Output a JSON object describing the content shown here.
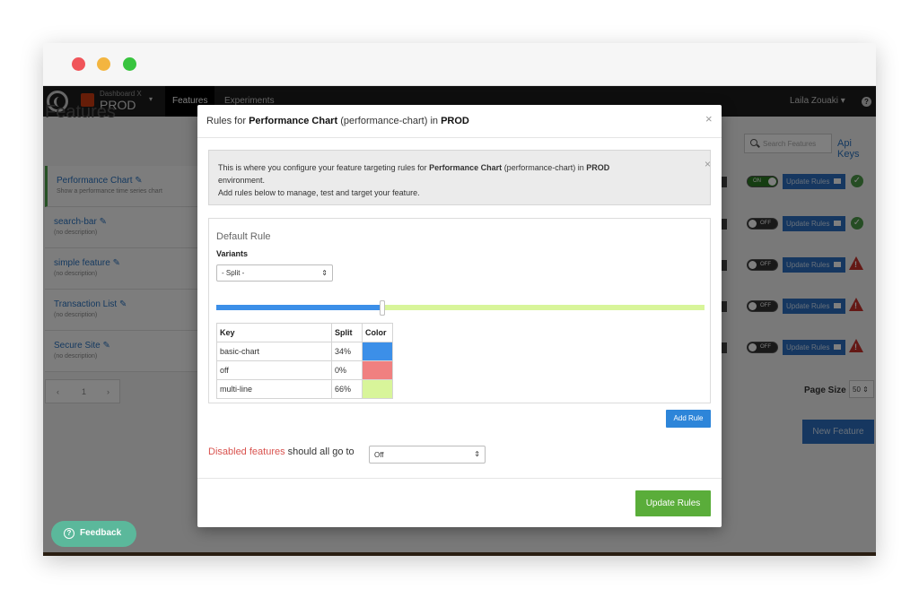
{
  "app": {
    "name_small": "Dashboard X",
    "environment": "PROD",
    "nav_tabs": [
      "Features",
      "Experiments"
    ],
    "user": "Laila Zouaki",
    "user_caret": "▾",
    "help": "?"
  },
  "page": {
    "title": "Features",
    "search_placeholder": "Search Features",
    "api_keys": "Api Keys",
    "page_size_label": "Page Size",
    "page_size_value": "50",
    "new_feature": "New Feature",
    "pagination": {
      "prev": "‹",
      "current": "1",
      "next": "›"
    }
  },
  "features": [
    {
      "name": "Performance Chart",
      "description": "Show a performance time series chart",
      "toggle": "ON",
      "status": "ok"
    },
    {
      "name": "search-bar",
      "description": "(no description)",
      "toggle": "OFF",
      "status": "ok"
    },
    {
      "name": "simple feature",
      "description": "(no description)",
      "toggle": "OFF",
      "status": "warning"
    },
    {
      "name": "Transaction List",
      "description": "(no description)",
      "toggle": "OFF",
      "status": "warning"
    },
    {
      "name": "Secure Site",
      "description": "(no description)",
      "toggle": "OFF",
      "status": "warning"
    }
  ],
  "feature_actions": {
    "update_rules": "Update Rules"
  },
  "modal": {
    "title_prefix": "Rules for",
    "feature_name": "Performance Chart",
    "feature_key": "(performance-chart)",
    "title_in": "in",
    "environment": "PROD",
    "close": "×",
    "info": {
      "line1_prefix": "This is where you configure your feature targeting rules for",
      "feature_name": "Performance Chart",
      "feature_key": "(performance-chart)",
      "in": "in",
      "environment": "PROD",
      "line2": "environment.",
      "line3": "Add rules below to manage, test and target your feature.",
      "close": "×"
    },
    "rule": {
      "title": "Default Rule",
      "variants_label": "Variants",
      "variant_select": "- Split -",
      "split": [
        {
          "key": "basic-chart",
          "split": "34%",
          "fraction": 0.34,
          "color": "#3c8fe8"
        },
        {
          "key": "off",
          "split": "0%",
          "fraction": 0.0,
          "color": "#f08080"
        },
        {
          "key": "multi-line",
          "split": "66%",
          "fraction": 0.66,
          "color": "#d8f59a"
        }
      ],
      "table_headers": {
        "key": "Key",
        "split": "Split",
        "color": "Color"
      }
    },
    "add_rule": "Add Rule",
    "disabled": {
      "red_text": "Disabled features",
      "rest_text": "should all go to",
      "select_value": "Off"
    },
    "update_rules": "Update Rules"
  },
  "feedback": {
    "label": "Feedback",
    "icon": "question-circle-icon"
  },
  "colors": {
    "primary": "#2d6fc0",
    "success": "#5aad3a",
    "danger": "#d9534f",
    "feedback": "#5bb89b"
  }
}
